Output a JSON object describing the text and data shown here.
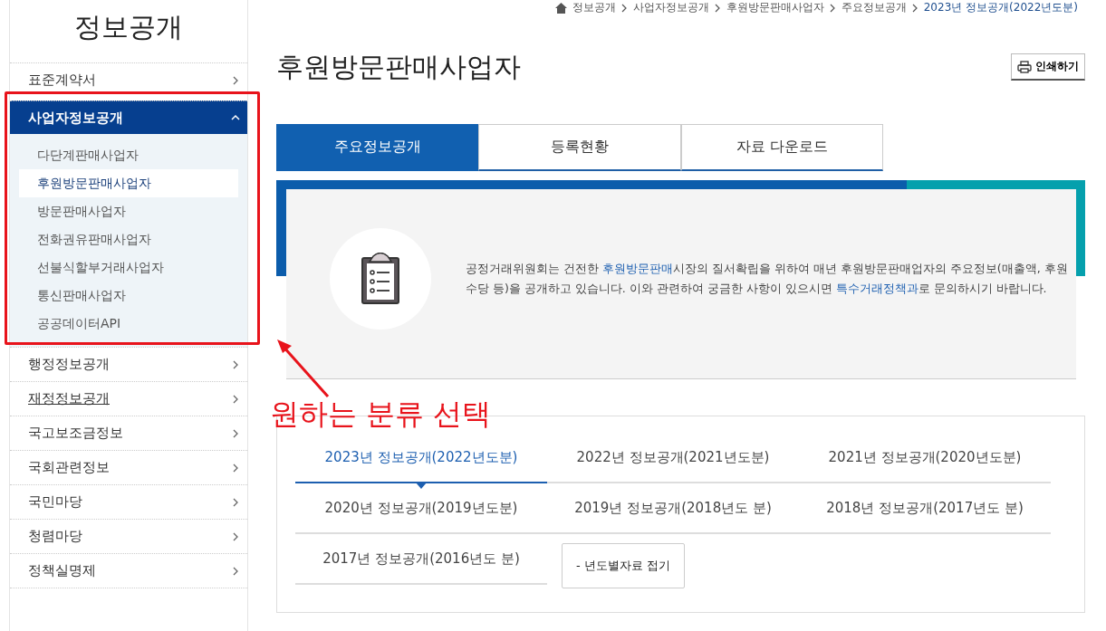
{
  "breadcrumb": [
    {
      "label": "정보공개",
      "current": false
    },
    {
      "label": "사업자정보공개",
      "current": false
    },
    {
      "label": "후원방문판매사업자",
      "current": false
    },
    {
      "label": "주요정보공개",
      "current": false
    },
    {
      "label": "2023년 정보공개(2022년도분)",
      "current": true
    }
  ],
  "sidebar": {
    "title": "정보공개",
    "items": [
      {
        "label": "표준계약서",
        "expanded": false,
        "hovered": false
      },
      {
        "label": "사업자정보공개",
        "expanded": true,
        "hovered": false,
        "children": [
          {
            "label": "다단계판매사업자",
            "selected": false
          },
          {
            "label": "후원방문판매사업자",
            "selected": true
          },
          {
            "label": "방문판매사업자",
            "selected": false
          },
          {
            "label": "전화권유판매사업자",
            "selected": false
          },
          {
            "label": "선불식할부거래사업자",
            "selected": false
          },
          {
            "label": "통신판매사업자",
            "selected": false
          },
          {
            "label": "공공데이터API",
            "selected": false
          }
        ]
      },
      {
        "label": "행정정보공개",
        "expanded": false,
        "hovered": false
      },
      {
        "label": "재정정보공개",
        "expanded": false,
        "hovered": true
      },
      {
        "label": "국고보조금정보",
        "expanded": false,
        "hovered": false
      },
      {
        "label": "국회관련정보",
        "expanded": false,
        "hovered": false
      },
      {
        "label": "국민마당",
        "expanded": false,
        "hovered": false
      },
      {
        "label": "청렴마당",
        "expanded": false,
        "hovered": false
      },
      {
        "label": "정책실명제",
        "expanded": false,
        "hovered": false
      }
    ]
  },
  "page": {
    "title": "후원방문판매사업자",
    "print_button": "인쇄하기"
  },
  "tabs": [
    {
      "label": "주요정보공개",
      "selected": true
    },
    {
      "label": "등록현황",
      "selected": false
    },
    {
      "label": "자료 다운로드",
      "selected": false
    }
  ],
  "intro": [
    {
      "kind": "text",
      "text": "공정거래위원회는 건전한 "
    },
    {
      "kind": "link",
      "text": "후원방문판매"
    },
    {
      "kind": "text",
      "text": "시장의 질서확립을 위하여 매년 후원방문판매업자의 주요정보(매출액, 후원수당 등)을 공개하고 있습니다. 이와 관련하여 궁금한 사항이 있으시면 "
    },
    {
      "kind": "link",
      "text": "특수거래정책과"
    },
    {
      "kind": "text",
      "text": "로 문의하시기 바랍니다."
    }
  ],
  "years": [
    {
      "label": "2023년 정보공개(2022년도분)",
      "selected": true
    },
    {
      "label": "2022년 정보공개(2021년도분)",
      "selected": false
    },
    {
      "label": "2021년 정보공개(2020년도분)",
      "selected": false
    },
    {
      "label": "2020년 정보공개(2019년도분)",
      "selected": false
    },
    {
      "label": "2019년 정보공개(2018년도 분)",
      "selected": false
    },
    {
      "label": "2018년 정보공개(2017년도 분)",
      "selected": false
    },
    {
      "label": "2017년 정보공개(2016년도 분)",
      "selected": false
    }
  ],
  "collapse_button": "- 년도별자료 접기",
  "annotation": {
    "label": "원하는 분류 선택"
  }
}
